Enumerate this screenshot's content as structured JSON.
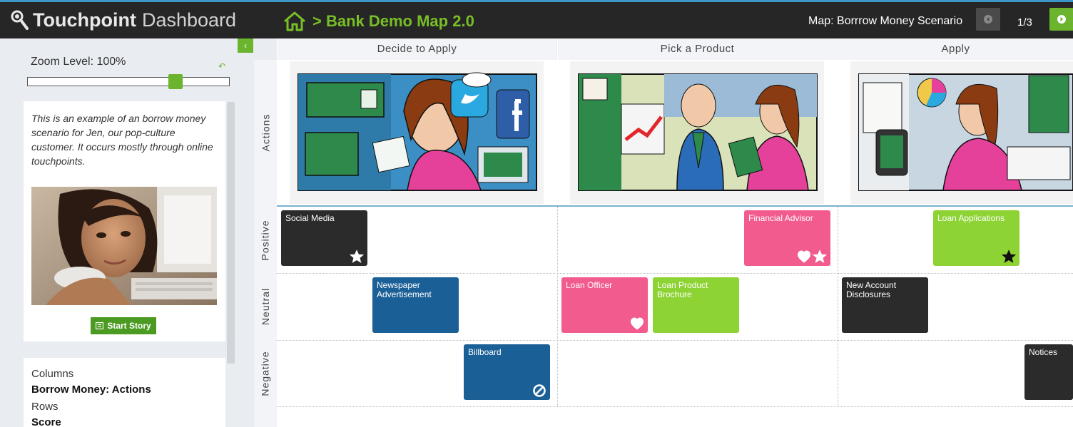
{
  "header": {
    "brand_bold": "Touchpoint",
    "brand_light": "Dashboard",
    "breadcrumb": "> Bank Demo Map 2.0",
    "map_label": "Map: Borrrow Money Scenario",
    "page_indicator": "1/3"
  },
  "sidebar": {
    "collapse_glyph": "‹",
    "zoom_label": "Zoom Level: 100%",
    "zoom_level": 0.75,
    "reset_glyph": "↶",
    "story_text": "This is an example of an borrow money scenario for Jen, our pop-culture customer. It occurs mostly through online touchpoints.",
    "start_story_label": "Start Story",
    "info": {
      "columns_label": "Columns",
      "columns_value": "Borrow Money: Actions",
      "rows_label": "Rows",
      "rows_value": "Score"
    }
  },
  "map": {
    "columns": [
      "Decide to Apply",
      "Pick a Product",
      "Apply"
    ],
    "rows": [
      "Actions",
      "Positive",
      "Neutral",
      "Negative"
    ],
    "cards": [
      {
        "label": "Social Media",
        "color": "#2b2b2b",
        "icons": [
          "star-white"
        ]
      },
      {
        "label": "Financial Advisor",
        "color": "#f25b8d",
        "icons": [
          "heart-white",
          "star-white"
        ]
      },
      {
        "label": "Loan Applications",
        "color": "#8ed334",
        "icons": [
          "star-black"
        ]
      },
      {
        "label": "Newspaper Advertisement",
        "color": "#1b5f97",
        "icons": []
      },
      {
        "label": "Loan Officer",
        "color": "#f25b8d",
        "icons": [
          "heart-white"
        ]
      },
      {
        "label": "Loan Product Brochure",
        "color": "#8ed334",
        "icons": []
      },
      {
        "label": "New Account Disclosures",
        "color": "#2b2b2b",
        "icons": []
      },
      {
        "label": "Billboard",
        "color": "#1b5f97",
        "icons": [
          "ban-white"
        ]
      },
      {
        "label": "Notices",
        "color": "#2b2b2b",
        "icons": []
      }
    ]
  },
  "colors": {
    "header_bg": "#262626",
    "accent_green": "#6ab42e",
    "breadcrumb_green": "#78bf26",
    "sidebar_bg": "#e9edf2"
  }
}
